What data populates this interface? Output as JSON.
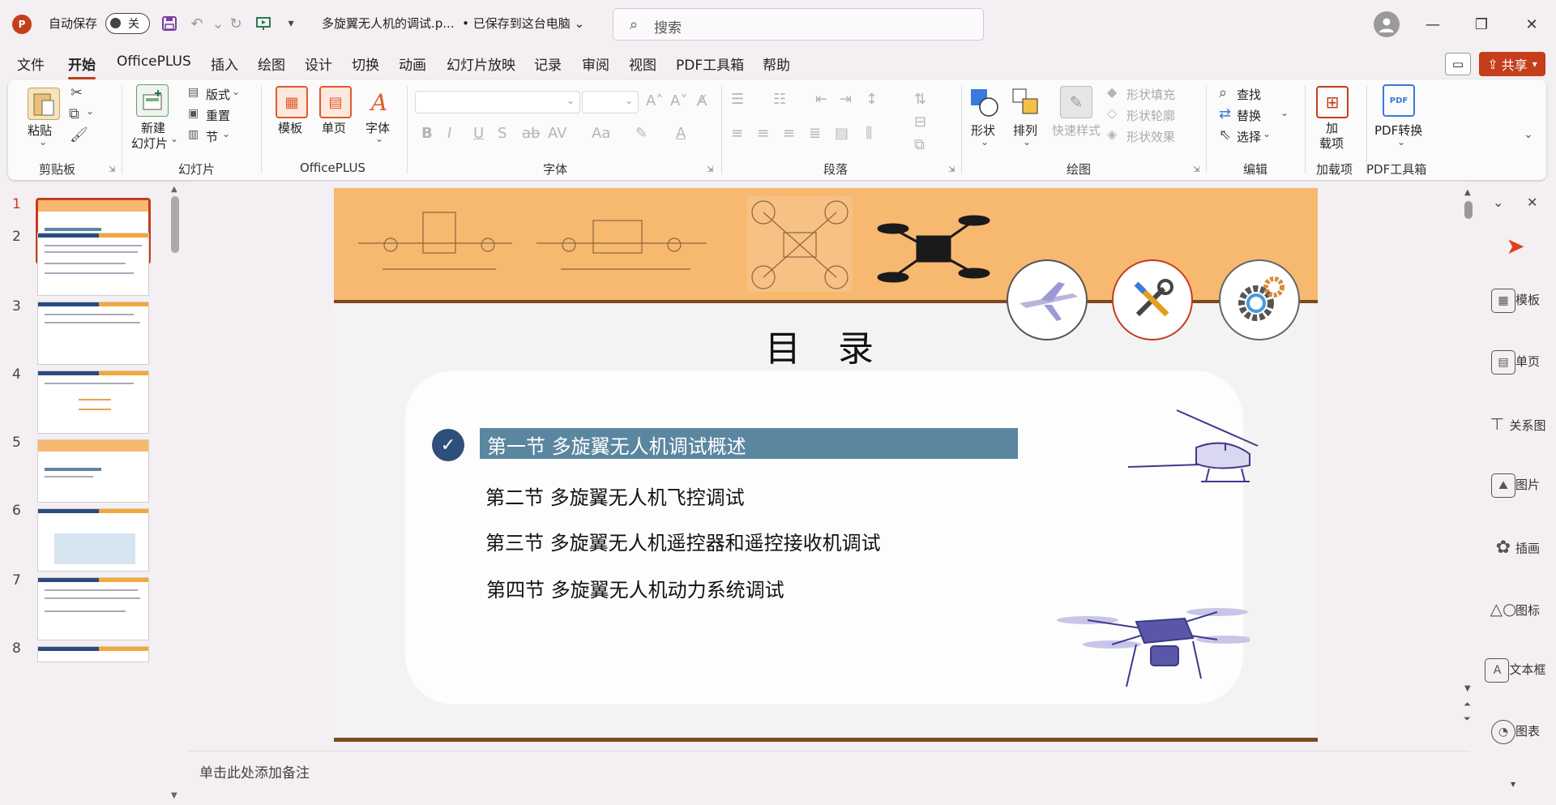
{
  "titlebar": {
    "app_icon": "P",
    "autosave_label": "自动保存",
    "autosave_state": "关",
    "doc_title": "多旋翼无人机的调试.p...",
    "save_status": "• 已保存到这台电脑",
    "search_placeholder": "搜索"
  },
  "menu": {
    "items": [
      "文件",
      "开始",
      "OfficePLUS",
      "插入",
      "绘图",
      "设计",
      "切换",
      "动画",
      "幻灯片放映",
      "记录",
      "审阅",
      "视图",
      "PDF工具箱",
      "帮助"
    ],
    "active": "开始",
    "share_label": "共享"
  },
  "ribbon": {
    "clipboard": {
      "label": "剪贴板",
      "paste": "粘贴"
    },
    "slides": {
      "label": "幻灯片",
      "new_slide_1": "新建",
      "new_slide_2": "幻灯片",
      "layout": "版式",
      "reset": "重置",
      "section": "节"
    },
    "officeplus": {
      "label": "OfficePLUS",
      "template": "模板",
      "single_page": "单页",
      "font": "字体"
    },
    "font": {
      "label": "字体"
    },
    "paragraph": {
      "label": "段落"
    },
    "drawing": {
      "label": "绘图",
      "shape": "形状",
      "arrange": "排列",
      "quick_style": "快速样式",
      "shape_fill": "形状填充",
      "shape_outline": "形状轮廓",
      "shape_effect": "形状效果"
    },
    "editing": {
      "label": "编辑",
      "find": "查找",
      "replace": "替换",
      "select": "选择"
    },
    "addins": {
      "label": "加载项",
      "addin_1": "加",
      "addin_2": "载项"
    },
    "pdf": {
      "label": "PDF工具箱",
      "convert": "PDF转换"
    }
  },
  "thumbnails": {
    "numbers": [
      "1",
      "2",
      "3",
      "4",
      "5",
      "6",
      "7",
      "8"
    ],
    "selected": "1"
  },
  "slide": {
    "title": "目 录",
    "items": [
      "第一节  多旋翼无人机调试概述",
      "第二节  多旋翼无人机飞控调试",
      "第三节  多旋翼无人机遥控器和遥控接收机调试",
      "第四节  多旋翼无人机动力系统调试"
    ],
    "active_item_index": 0,
    "colors": {
      "band": "#f7b870",
      "active_bar": "#5b86a0",
      "check": "#2f4f7a",
      "line": "#7a4a20"
    }
  },
  "notes": {
    "placeholder": "单击此处添加备注"
  },
  "right_panel": {
    "items": [
      "模板",
      "单页",
      "关系图",
      "图片",
      "插画",
      "图标",
      "文本框",
      "图表"
    ]
  }
}
